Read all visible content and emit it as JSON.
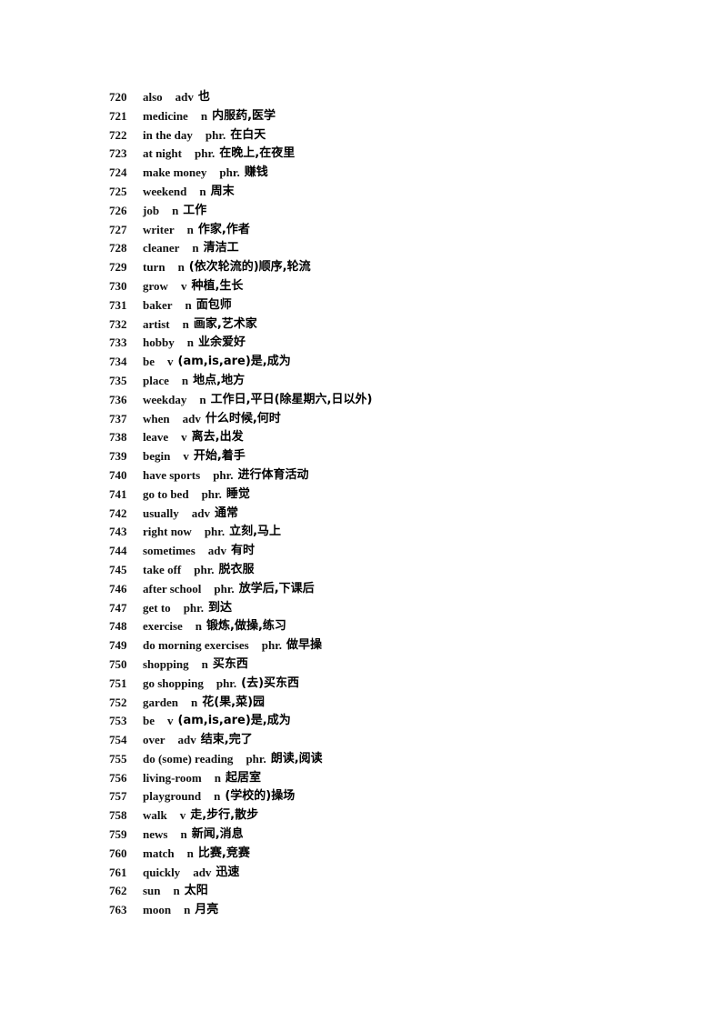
{
  "entries": [
    {
      "num": "720",
      "word": "also",
      "pos": "adv",
      "meaning": "也"
    },
    {
      "num": "721",
      "word": "medicine",
      "pos": "n",
      "meaning": "内服药,医学"
    },
    {
      "num": "722",
      "word": "in the day",
      "pos": "phr.",
      "meaning": "在白天"
    },
    {
      "num": "723",
      "word": "at night",
      "pos": "phr.",
      "meaning": "在晚上,在夜里"
    },
    {
      "num": "724",
      "word": "make money",
      "pos": "phr.",
      "meaning": "赚钱"
    },
    {
      "num": "725",
      "word": "weekend",
      "pos": "n",
      "meaning": "周末"
    },
    {
      "num": "726",
      "word": "job",
      "pos": "n",
      "meaning": "工作"
    },
    {
      "num": "727",
      "word": "writer",
      "pos": "n",
      "meaning": "作家,作者"
    },
    {
      "num": "728",
      "word": "cleaner",
      "pos": "n",
      "meaning": "清洁工"
    },
    {
      "num": "729",
      "word": "turn",
      "pos": "n",
      "meaning": "(依次轮流的)顺序,轮流"
    },
    {
      "num": "730",
      "word": "grow",
      "pos": "v",
      "meaning": "种植,生长"
    },
    {
      "num": "731",
      "word": "baker",
      "pos": "n",
      "meaning": "面包师"
    },
    {
      "num": "732",
      "word": "artist",
      "pos": "n",
      "meaning": "画家,艺术家"
    },
    {
      "num": "733",
      "word": "hobby",
      "pos": "n",
      "meaning": "业余爱好"
    },
    {
      "num": "734",
      "word": "be",
      "pos": "v",
      "meaning": "(am,is,are)是,成为"
    },
    {
      "num": "735",
      "word": "place",
      "pos": "n",
      "meaning": "地点,地方"
    },
    {
      "num": "736",
      "word": "weekday",
      "pos": "n",
      "meaning": "工作日,平日(除星期六,日以外)"
    },
    {
      "num": "737",
      "word": "when",
      "pos": "adv",
      "meaning": "什么时候,何时"
    },
    {
      "num": "738",
      "word": "leave",
      "pos": "v",
      "meaning": "离去,出发"
    },
    {
      "num": "739",
      "word": "begin",
      "pos": "v",
      "meaning": "开始,着手"
    },
    {
      "num": "740",
      "word": "have sports",
      "pos": "phr.",
      "meaning": "进行体育活动"
    },
    {
      "num": "741",
      "word": "go to bed",
      "pos": "phr.",
      "meaning": "睡觉"
    },
    {
      "num": "742",
      "word": "usually",
      "pos": "adv",
      "meaning": "通常"
    },
    {
      "num": "743",
      "word": "right now",
      "pos": "phr.",
      "meaning": "立刻,马上"
    },
    {
      "num": "744",
      "word": "sometimes",
      "pos": "adv",
      "meaning": "有时"
    },
    {
      "num": "745",
      "word": "take off",
      "pos": "phr.",
      "meaning": "脱衣服"
    },
    {
      "num": "746",
      "word": "after school",
      "pos": "phr.",
      "meaning": "放学后,下课后"
    },
    {
      "num": "747",
      "word": "get to",
      "pos": "phr.",
      "meaning": "到达"
    },
    {
      "num": "748",
      "word": "exercise",
      "pos": "n",
      "meaning": "锻炼,做操,练习"
    },
    {
      "num": "749",
      "word": "do morning exercises",
      "pos": "phr.",
      "meaning": "做早操"
    },
    {
      "num": "750",
      "word": "shopping",
      "pos": "n",
      "meaning": "买东西"
    },
    {
      "num": "751",
      "word": "go shopping",
      "pos": "phr.",
      "meaning": "(去)买东西"
    },
    {
      "num": "752",
      "word": "garden",
      "pos": "n",
      "meaning": "花(果,菜)园"
    },
    {
      "num": "753",
      "word": "be",
      "pos": "v",
      "meaning": "(am,is,are)是,成为"
    },
    {
      "num": "754",
      "word": "over",
      "pos": "adv",
      "meaning": "结束,完了"
    },
    {
      "num": "755",
      "word": "do (some) reading",
      "pos": "phr.",
      "meaning": "朗读,阅读"
    },
    {
      "num": "756",
      "word": "living-room",
      "pos": "n",
      "meaning": "起居室"
    },
    {
      "num": "757",
      "word": "playground",
      "pos": "n",
      "meaning": "(学校的)操场"
    },
    {
      "num": "758",
      "word": "walk",
      "pos": "v",
      "meaning": "走,步行,散步"
    },
    {
      "num": "759",
      "word": "news",
      "pos": "n",
      "meaning": "新闻,消息"
    },
    {
      "num": "760",
      "word": "match",
      "pos": "n",
      "meaning": "比赛,竞赛"
    },
    {
      "num": "761",
      "word": "quickly",
      "pos": "adv",
      "meaning": "迅速"
    },
    {
      "num": "762",
      "word": "sun",
      "pos": "n",
      "meaning": "太阳"
    },
    {
      "num": "763",
      "word": "moon",
      "pos": "n",
      "meaning": "月亮"
    }
  ]
}
